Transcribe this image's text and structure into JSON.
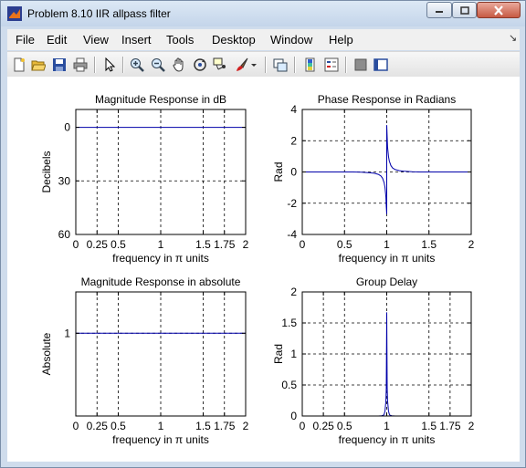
{
  "window": {
    "title": "Problem 8.10 IIR allpass filter"
  },
  "menu": {
    "items": [
      "File",
      "Edit",
      "View",
      "Insert",
      "Tools",
      "Desktop",
      "Window",
      "Help"
    ]
  },
  "toolbar": {
    "icons": [
      "new-figure-icon",
      "open-file-icon",
      "save-icon",
      "print-icon",
      "pointer-icon",
      "zoom-in-icon",
      "zoom-out-icon",
      "pan-icon",
      "rotate-3d-icon",
      "data-cursor-icon",
      "brush-icon",
      "dropdown-arrow-icon",
      "link-plot-icon",
      "colorbar-icon",
      "legend-icon",
      "hide-plot-tools-icon",
      "show-plot-tools-icon"
    ]
  },
  "colors": {
    "line": "#0000aa",
    "titlebar": "#c4d5ea"
  },
  "chart_data": [
    {
      "type": "line",
      "title": "Magnitude Response in dB",
      "xlabel": "frequency in π units",
      "ylabel": "Decibels",
      "xlim": [
        0,
        2
      ],
      "ylim": [
        -60,
        10
      ],
      "y_reversed_labels": true,
      "xticks": [
        0,
        0.25,
        0.5,
        1,
        1.5,
        1.75,
        2
      ],
      "xtick_labels": [
        "0",
        "0.25",
        "0.5",
        "1",
        "1.5",
        "1.75",
        "2"
      ],
      "yticks": [
        0,
        -30,
        -60
      ],
      "ytick_labels": [
        "0",
        "30",
        "60"
      ],
      "gridx": [
        0.25,
        0.5,
        1,
        1.5,
        1.75
      ],
      "gridy": [
        -30
      ],
      "series": [
        {
          "x": [
            0,
            2
          ],
          "y": [
            0,
            0
          ]
        }
      ]
    },
    {
      "type": "line",
      "title": "Phase Response in Radians",
      "xlabel": "frequency in π units",
      "ylabel": "Rad",
      "xlim": [
        0,
        2
      ],
      "ylim": [
        -4,
        4
      ],
      "xticks": [
        0,
        0.5,
        1,
        1.5,
        2
      ],
      "xtick_labels": [
        "0",
        "0.5",
        "1",
        "1.5",
        "2"
      ],
      "yticks": [
        -4,
        -2,
        0,
        2,
        4
      ],
      "ytick_labels": [
        "-4",
        "-2",
        "0",
        "2",
        "4"
      ],
      "gridx": [
        0.5,
        1,
        1.5
      ],
      "gridy": [
        -2,
        0,
        2
      ],
      "series": [
        {
          "x": [
            0,
            0.6,
            0.7,
            0.8,
            0.85,
            0.9,
            0.93,
            0.95,
            0.97,
            0.98,
            0.99,
            0.995,
            1.0,
            1.0,
            1.005,
            1.01,
            1.02,
            1.03,
            1.05,
            1.07,
            1.1,
            1.15,
            1.2,
            1.3,
            1.4,
            2
          ],
          "y": [
            0,
            0,
            -0.02,
            -0.05,
            -0.08,
            -0.15,
            -0.25,
            -0.4,
            -0.7,
            -1.0,
            -1.6,
            -2.2,
            -2.7,
            3.0,
            2.2,
            1.6,
            1.0,
            0.7,
            0.4,
            0.25,
            0.15,
            0.08,
            0.05,
            0.02,
            0,
            0
          ]
        }
      ]
    },
    {
      "type": "line",
      "title": "Magnitude Response in absolute",
      "xlabel": "frequency in π units",
      "ylabel": "Absolute",
      "xlim": [
        0,
        2
      ],
      "ylim": [
        0,
        1.5
      ],
      "xticks": [
        0,
        0.25,
        0.5,
        1,
        1.5,
        1.75,
        2
      ],
      "xtick_labels": [
        "0",
        "0.25",
        "0.5",
        "1",
        "1.5",
        "1.75",
        "2"
      ],
      "yticks": [
        1
      ],
      "ytick_labels": [
        "1"
      ],
      "gridx": [
        0.25,
        0.5,
        1,
        1.5,
        1.75
      ],
      "gridy": [
        1
      ],
      "series": [
        {
          "x": [
            0,
            2
          ],
          "y": [
            1,
            1
          ]
        }
      ]
    },
    {
      "type": "line",
      "title": "Group Delay",
      "xlabel": "frequency in π units",
      "ylabel": "Rad",
      "xlim": [
        0,
        2
      ],
      "ylim": [
        0,
        2
      ],
      "xticks": [
        0,
        0.25,
        0.5,
        1,
        1.5,
        1.75,
        2
      ],
      "xtick_labels": [
        "0",
        "0.25",
        "0.5",
        "1",
        "1.5",
        "1.75",
        "2"
      ],
      "yticks": [
        0,
        0.5,
        1,
        1.5,
        2
      ],
      "ytick_labels": [
        "0",
        "0.5",
        "1",
        "1.5",
        "2"
      ],
      "gridx": [
        0.25,
        0.5,
        1,
        1.5,
        1.75
      ],
      "gridy": [
        0.5,
        1,
        1.5
      ],
      "series": [
        {
          "x": [
            0,
            0.9,
            0.94,
            0.96,
            0.97,
            0.98,
            0.99,
            0.995,
            1.0,
            1.005,
            1.01,
            1.02,
            1.03,
            1.04,
            1.06,
            1.1,
            2
          ],
          "y": [
            0,
            0,
            0.005,
            0.01,
            0.03,
            0.08,
            0.25,
            0.45,
            1.67,
            0.45,
            0.25,
            0.08,
            0.03,
            0.01,
            0.005,
            0,
            0
          ]
        }
      ]
    }
  ]
}
